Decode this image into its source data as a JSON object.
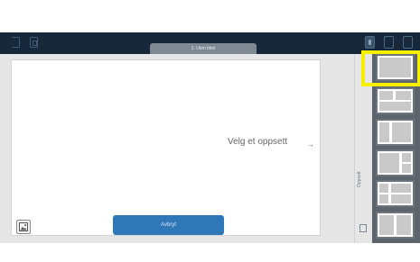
{
  "toolbar": {
    "page_tab_label": "1. Uten tittel"
  },
  "canvas": {
    "hint_text": "Velg et oppsett",
    "arrow": "→"
  },
  "actions": {
    "cancel_label": "Avbryt"
  },
  "layout_panel": {
    "label": "Oppsett",
    "layouts": [
      "layout-full",
      "layout-two-top-one-bottom",
      "layout-two-columns",
      "layout-three",
      "layout-grid",
      "layout-four"
    ]
  },
  "colors": {
    "toolbar_bg": "#16283a",
    "cancel_bg": "#2f78b8",
    "panel_bg": "#5d646b",
    "highlight": "#f6ef00"
  }
}
